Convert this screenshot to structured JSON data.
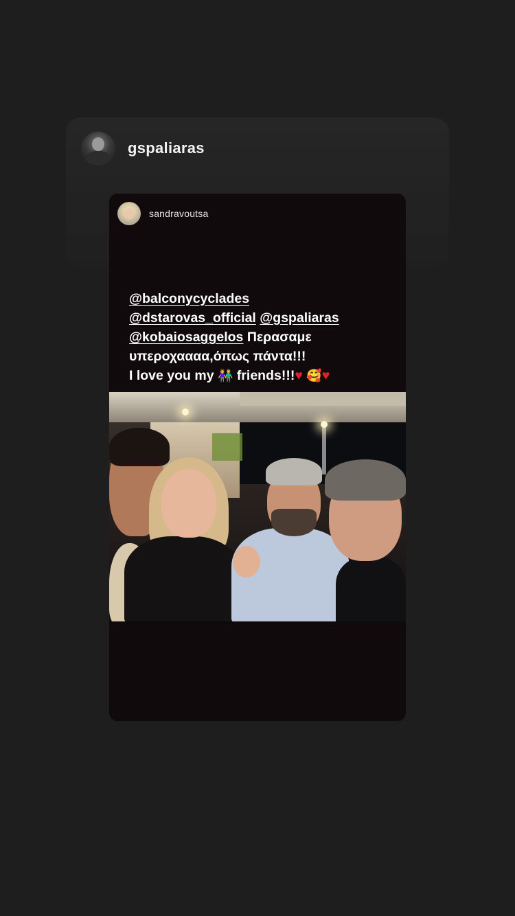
{
  "shared_post": {
    "author": "gspaliaras",
    "avatar_icon": "profile-photo-icon"
  },
  "story": {
    "handle": "sandravoutsa",
    "avatar_icon": "profile-photo-icon",
    "caption": {
      "mention_1": "@balconycyclades",
      "mention_2": "@dstarovas_official",
      "mention_3": "@gspaliaras",
      "mention_4": "@kobaiosaggelos",
      "text_1": "Περασαμε",
      "text_2": "υπεροχαααα,όπως πάντα!!!",
      "text_3": "I love you my",
      "emoji_couple": "👫",
      "text_4": "friends!!!",
      "emoji_heart": "♥",
      "emoji_smile": "🥰"
    },
    "photo_description_icon": "group-photo-icon"
  },
  "colors": {
    "background": "#1e1e1e",
    "story_bg": "#110a0d",
    "heart": "#e0202a"
  }
}
